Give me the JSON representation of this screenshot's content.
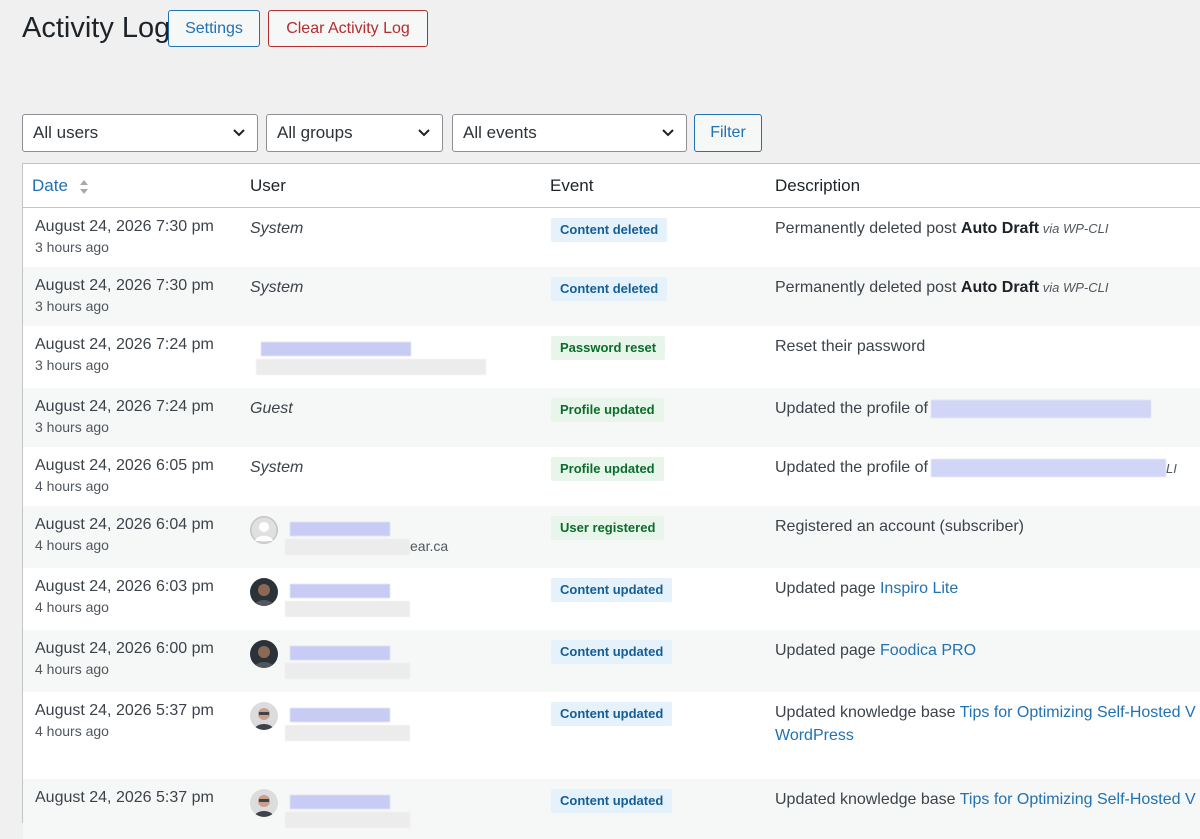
{
  "header": {
    "title": "Activity Log",
    "settings_label": "Settings",
    "clear_label": "Clear Activity Log"
  },
  "filters": {
    "users": "All users",
    "groups": "All groups",
    "events": "All events",
    "filter_label": "Filter"
  },
  "table": {
    "columns": [
      "Date",
      "User",
      "Event",
      "Description"
    ],
    "rows": [
      {
        "date": "August 24, 2026 7:30 pm",
        "ago": "3 hours ago",
        "user": "System",
        "event": "Content deleted",
        "event_color": "blue",
        "desc_pre": "Permanently deleted post ",
        "desc_bold": "Auto Draft",
        "desc_via": " via WP-CLI"
      },
      {
        "date": "August 24, 2026 7:30 pm",
        "ago": "3 hours ago",
        "user": "System",
        "event": "Content deleted",
        "event_color": "blue",
        "desc_pre": "Permanently deleted post ",
        "desc_bold": "Auto Draft",
        "desc_via": " via WP-CLI"
      },
      {
        "date": "August 24, 2026 7:24 pm",
        "ago": "3 hours ago",
        "user": "",
        "event": "Password reset",
        "event_color": "green",
        "desc_pre": "Reset their password"
      },
      {
        "date": "August 24, 2026 7:24 pm",
        "ago": "3 hours ago",
        "user": "Guest",
        "event": "Profile updated",
        "event_color": "green",
        "desc_pre": "Updated the profile of"
      },
      {
        "date": "August 24, 2026 6:05 pm",
        "ago": "4 hours ago",
        "user": "System",
        "event": "Profile updated",
        "event_color": "green",
        "desc_pre": "Updated the profile of",
        "desc_tail": "LI"
      },
      {
        "date": "August 24, 2026 6:04 pm",
        "ago": "4 hours ago",
        "user": "",
        "user_email_tail": "ear.ca",
        "event": "User registered",
        "event_color": "green",
        "desc_pre": "Registered an account (subscriber)"
      },
      {
        "date": "August 24, 2026 6:03 pm",
        "ago": "4 hours ago",
        "user": "",
        "event": "Content updated",
        "event_color": "blue",
        "desc_pre": "Updated page ",
        "desc_link": "Inspiro Lite"
      },
      {
        "date": "August 24, 2026 6:00 pm",
        "ago": "4 hours ago",
        "user": "",
        "event": "Content updated",
        "event_color": "blue",
        "desc_pre": "Updated page ",
        "desc_link": "Foodica PRO"
      },
      {
        "date": "August 24, 2026 5:37 pm",
        "ago": "4 hours ago",
        "user": "",
        "event": "Content updated",
        "event_color": "blue",
        "desc_pre": "Updated knowledge base ",
        "desc_link": "Tips for Optimizing Self-Hosted V",
        "desc_link2": "WordPress"
      },
      {
        "date": "August 24, 2026 5:37 pm",
        "ago": "",
        "user": "",
        "event": "Content updated",
        "event_color": "blue",
        "desc_pre": "Updated knowledge base ",
        "desc_link": "Tips for Optimizing Self-Hosted V"
      }
    ]
  },
  "colors": {
    "accent": "#2271b1",
    "danger": "#b32d2e",
    "badge_blue_bg": "#e5f1fb",
    "badge_green_bg": "#e7f5ea"
  }
}
